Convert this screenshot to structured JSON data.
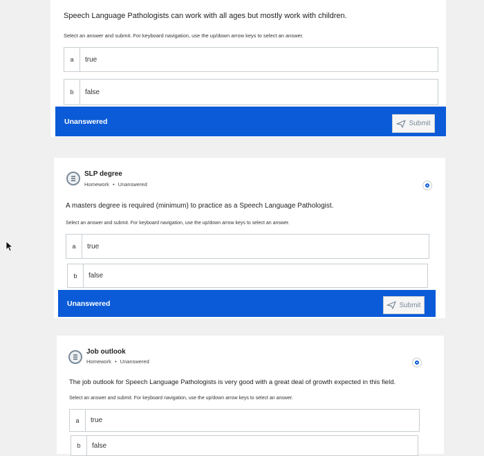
{
  "q1": {
    "question": "Speech Language Pathologists can work with all ages but mostly work with children.",
    "instructions": "Select an answer and submit. For keyboard navigation, use the up/down arrow keys to select an answer.",
    "options": [
      {
        "letter": "a",
        "text": "true"
      },
      {
        "letter": "b",
        "text": "false"
      }
    ],
    "status": "Unanswered",
    "submit_label": "Submit"
  },
  "q2": {
    "title": "SLP degree",
    "type": "Homework",
    "state": "Unanswered",
    "question": "A masters degree is required (minimum) to practice as a Speech Language Pathologist.",
    "instructions": "Select an answer and submit. For keyboard navigation, use the up/down arrow keys to select an answer.",
    "options": [
      {
        "letter": "a",
        "text": "true"
      },
      {
        "letter": "b",
        "text": "false"
      }
    ],
    "status": "Unanswered",
    "submit_label": "Submit"
  },
  "q3": {
    "title": "Job outlook",
    "type": "Homework",
    "state": "Unanswered",
    "question": "The job outlook for Speech Language Pathologists is very good with a great deal of growth expected in this field.",
    "instructions": "Select an answer and submit. For keyboard navigation, use the up/down arrow keys to select an answer.",
    "options": [
      {
        "letter": "a",
        "text": "true"
      },
      {
        "letter": "b",
        "text": "false"
      }
    ]
  },
  "meta_separator": "•",
  "colors": {
    "accent": "#0b5bd8",
    "border": "#c7cdd1"
  }
}
